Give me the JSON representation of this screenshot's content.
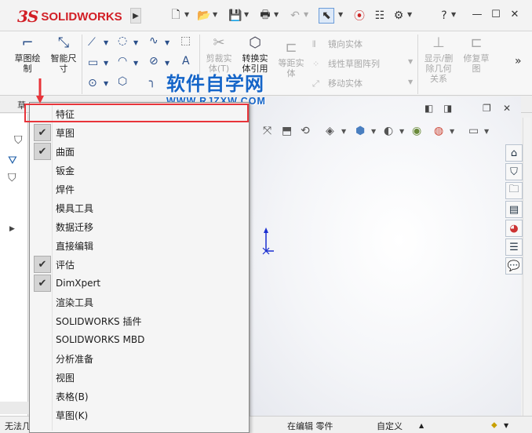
{
  "app": {
    "logo_prefix": "3S",
    "logo_name": "SOLIDWORKS"
  },
  "ribbon": {
    "sketch_label": "草图绘\n制",
    "smart_dim_label": "智能尺\n寸",
    "trim_label": "剪裁实\n体(T)",
    "convert_label": "转换实\n体引用",
    "offset_label": "等距实\n体",
    "mirror_label": "镜向实体",
    "linear_pattern_label": "线性草图阵列",
    "move_label": "移动实体",
    "show_delete_label": "显示/删\n除几何\n关系",
    "repair_label": "修复草\n图"
  },
  "tabs": {
    "sketch_tab": "草"
  },
  "watermark": {
    "cn": "软件自学网",
    "url": "WWW.RJZXW.COM"
  },
  "menu": {
    "items": [
      {
        "label": "特征",
        "checked": false
      },
      {
        "label": "草图",
        "checked": true
      },
      {
        "label": "曲面",
        "checked": true
      },
      {
        "label": "钣金",
        "checked": false
      },
      {
        "label": "焊件",
        "checked": false
      },
      {
        "label": "模具工具",
        "checked": false
      },
      {
        "label": "数据迁移",
        "checked": false
      },
      {
        "label": "直接编辑",
        "checked": false
      },
      {
        "label": "评估",
        "checked": true
      },
      {
        "label": "DimXpert",
        "checked": true
      },
      {
        "label": "渲染工具",
        "checked": false
      },
      {
        "label": "SOLIDWORKS 插件",
        "checked": false
      },
      {
        "label": "SOLIDWORKS MBD",
        "checked": false
      },
      {
        "label": "分析准备",
        "checked": false
      },
      {
        "label": "视图",
        "checked": false
      },
      {
        "label": "表格(B)",
        "checked": false
      },
      {
        "label": "草图(K)",
        "checked": false
      }
    ]
  },
  "status": {
    "left": "无法几",
    "editing": "在编辑 零件",
    "custom": "自定义"
  },
  "colors": {
    "brand_red": "#d21f26",
    "highlight_red": "#e8343a",
    "watermark_blue": "#1565c8"
  }
}
